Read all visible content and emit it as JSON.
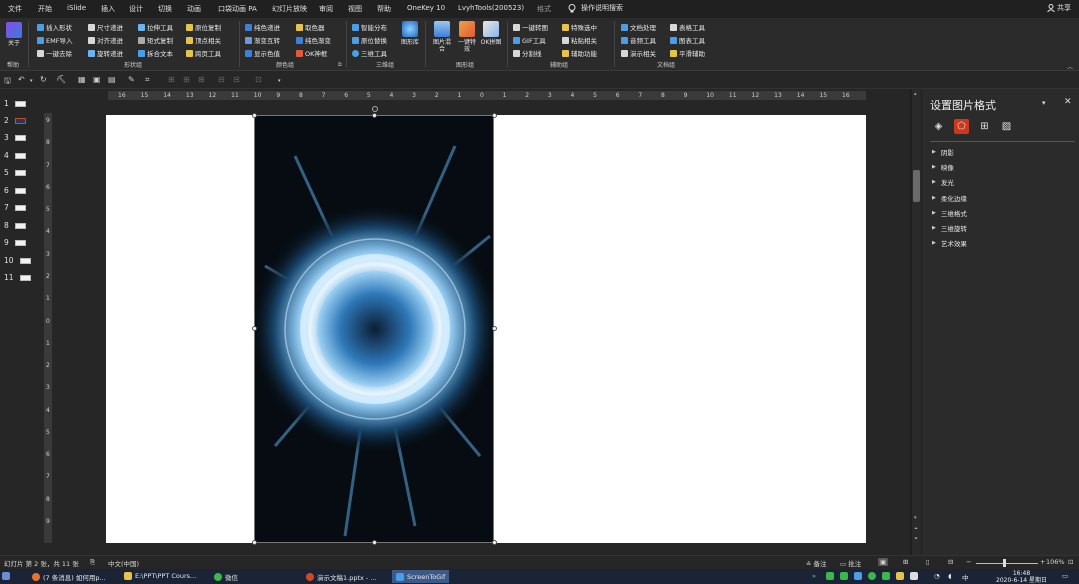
{
  "tabs": [
    "文件",
    "开始",
    "iSlide",
    "插入",
    "设计",
    "切换",
    "动画",
    "口袋动画 PA",
    "幻灯片放映",
    "审阅",
    "视图",
    "帮助",
    "OneKey 10",
    "LvyhTools(200523)",
    "格式"
  ],
  "search_hint": "操作说明搜索",
  "share_label": "共享",
  "ribbon": {
    "help_group": {
      "about_label": "关于",
      "group_label": "帮助"
    },
    "shape_group": {
      "items": [
        "插入形状",
        "尺寸递进",
        "拉伸工具",
        "原位复制",
        "EMF导入",
        "对齐递进",
        "矩式复制",
        "顶点相关",
        "一键去除",
        "旋转递进",
        "拆合文本",
        "跨页工具"
      ],
      "group_label": "形状组"
    },
    "color_group": {
      "items": [
        "纯色递进",
        "取色器",
        "渐变互转",
        "纯色渐变",
        "显示色值",
        "OK神框"
      ],
      "group_label": "颜色组"
    },
    "threed_group": {
      "items": [
        "智能分布",
        "原位替换",
        "三维工具"
      ],
      "big_label": "图形库",
      "group_label": "三维组"
    },
    "image_group": {
      "items": [
        "图片混合",
        "一键特效",
        "OK拼图"
      ],
      "group_label": "图形组"
    },
    "assist_group": {
      "items": [
        "一键转图",
        "特殊选中",
        "GIF工具",
        "粘贴相关",
        "分割线",
        "辅助功能"
      ],
      "group_label": "辅助组"
    },
    "doc_group": {
      "items": [
        "文档处理",
        "表格工具",
        "音频工具",
        "图表工具",
        "演示相关",
        "平滑辅助"
      ],
      "group_label": "文档组"
    }
  },
  "slides": [
    "1",
    "2",
    "3",
    "4",
    "5",
    "6",
    "7",
    "8",
    "9",
    "10",
    "11"
  ],
  "selected_slide": 2,
  "hruler_ticks": [
    "16",
    "15",
    "14",
    "13",
    "12",
    "11",
    "10",
    "9",
    "8",
    "7",
    "6",
    "5",
    "4",
    "3",
    "2",
    "1",
    "0",
    "1",
    "2",
    "3",
    "4",
    "5",
    "6",
    "7",
    "8",
    "9",
    "10",
    "11",
    "12",
    "13",
    "14",
    "15",
    "16"
  ],
  "vruler_ticks": [
    "9",
    "8",
    "7",
    "6",
    "5",
    "4",
    "3",
    "2",
    "1",
    "0",
    "1",
    "2",
    "3",
    "4",
    "5",
    "6",
    "7",
    "8",
    "9"
  ],
  "format_pane": {
    "title": "设置图片格式",
    "sections": [
      "阴影",
      "映像",
      "发光",
      "柔化边缘",
      "三维格式",
      "三维旋转",
      "艺术效果"
    ]
  },
  "status": {
    "slide_info": "幻灯片 第 2 张，共 11 张",
    "language": "中文(中国)",
    "notes": "备注",
    "comments": "批注",
    "zoom": "106%"
  },
  "taskbar": {
    "items": [
      "(7 条消息) 如何用p...",
      "E:\\PPT\\PPT Cours...",
      "微信",
      "演示文稿1.pptx - ...",
      "ScreenToGif"
    ],
    "time": "16:48",
    "date": "2020-6-14 星期日"
  },
  "colors": {
    "accent": "#c8391d",
    "selection": "#d24726",
    "taskbar": "#1a2436"
  }
}
